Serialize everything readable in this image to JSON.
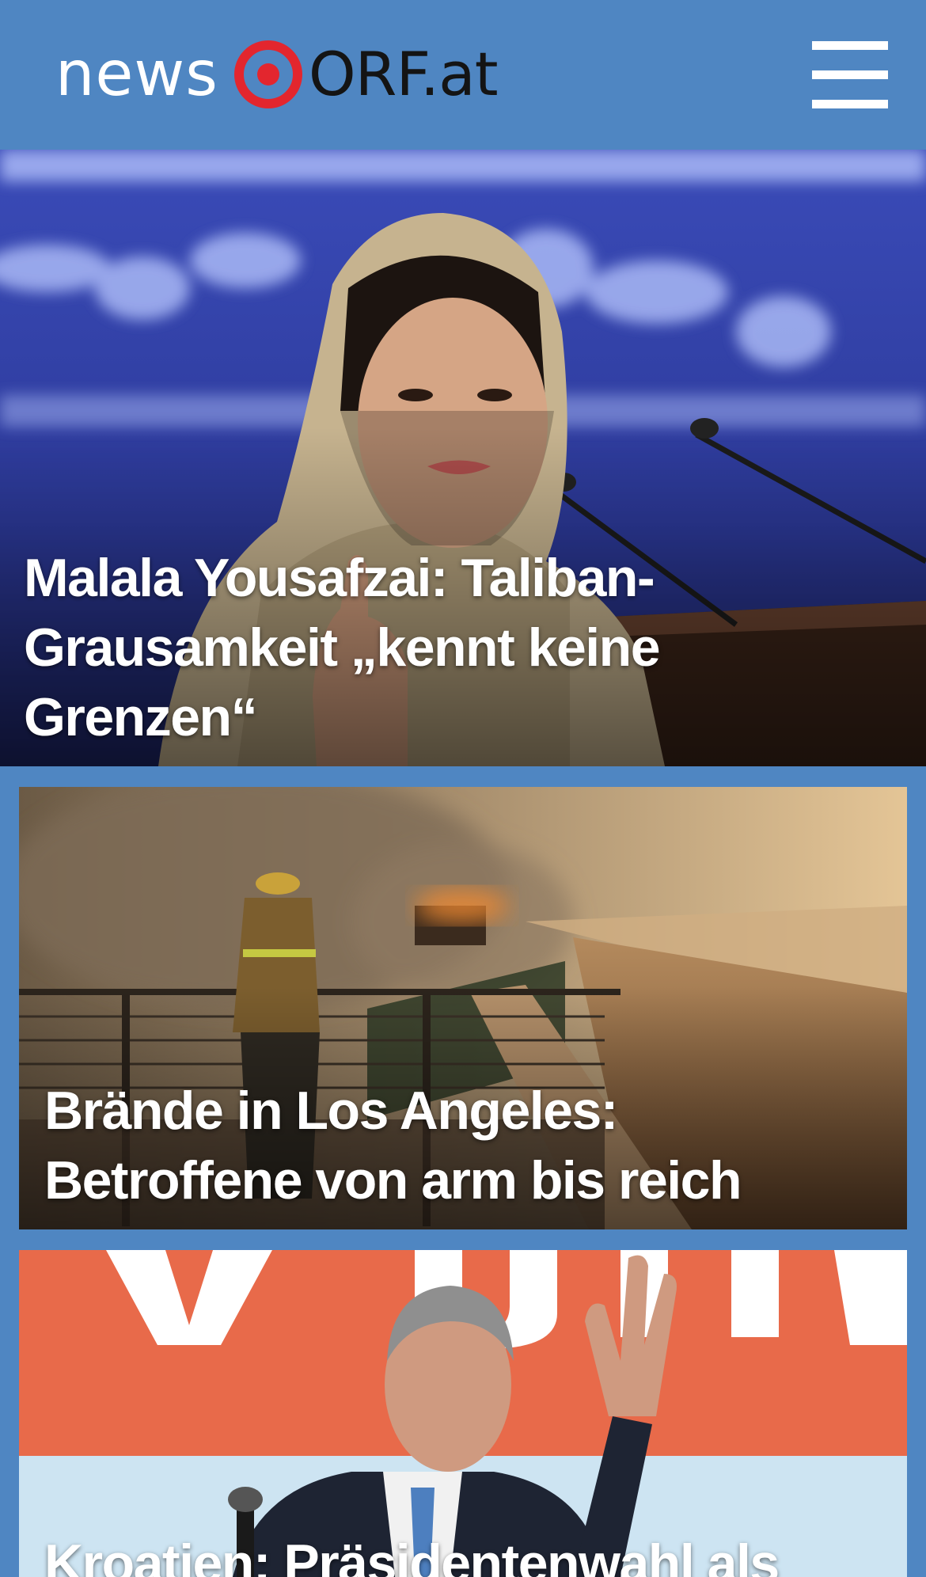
{
  "header": {
    "logo": {
      "news": "news",
      "orf": "ORF.at",
      "target_color": "#e3262e"
    },
    "menu_icon": "hamburger-menu-icon"
  },
  "articles": [
    {
      "headline": "Malala Yousafzai: Taliban-Grausamkeit „kennt keine Grenzen“"
    },
    {
      "headline": "Brände in Los Angeles: Betroffene von arm bis reich"
    },
    {
      "headline": "Kroatien: Präsidentenwahl als"
    }
  ],
  "colors": {
    "brand_blue": "#4f86c2",
    "brand_red": "#e3262e"
  }
}
